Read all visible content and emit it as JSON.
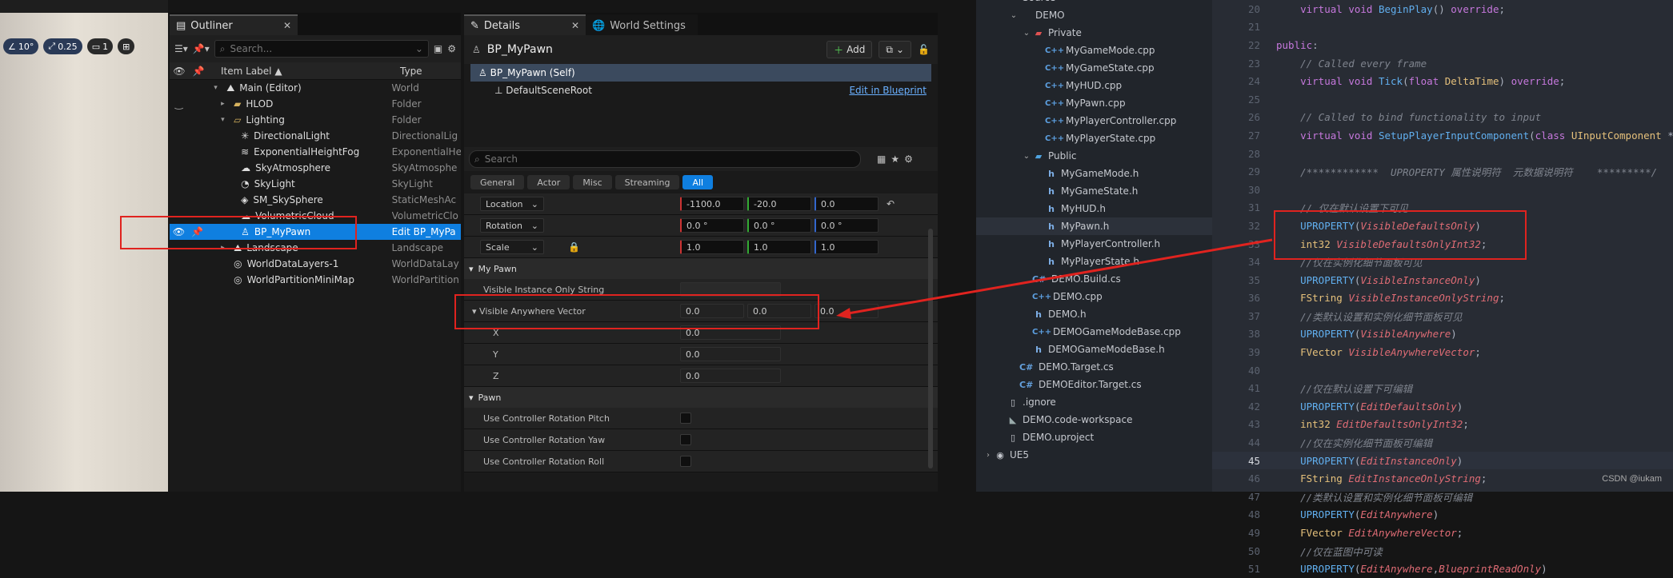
{
  "viewport": {
    "toolbar": [
      {
        "icon": "angle-icon",
        "label": "10°"
      },
      {
        "icon": "scale-icon",
        "label": "0.25"
      },
      {
        "icon": "camera-icon",
        "label": "1"
      }
    ]
  },
  "outliner": {
    "tab_label": "Outliner",
    "search_placeholder": "Search...",
    "columns": {
      "label": "Item Label ▲",
      "type": "Type"
    },
    "rows": [
      {
        "label": "Main (Editor)",
        "type": "World",
        "indent": 2,
        "icon": "world-icon",
        "expanded": true
      },
      {
        "label": "HLOD",
        "type": "Folder",
        "indent": 3,
        "icon": "folder-icon",
        "collapsed": true
      },
      {
        "label": "Lighting",
        "type": "Folder",
        "indent": 3,
        "icon": "folder-open-icon",
        "expanded": true
      },
      {
        "label": "DirectionalLight",
        "type": "DirectionalLig",
        "indent": 4,
        "icon": "sun-icon"
      },
      {
        "label": "ExponentialHeightFog",
        "type": "ExponentialHe",
        "indent": 4,
        "icon": "fog-icon"
      },
      {
        "label": "SkyAtmosphere",
        "type": "SkyAtmosphe",
        "indent": 4,
        "icon": "sky-icon"
      },
      {
        "label": "SkyLight",
        "type": "SkyLight",
        "indent": 4,
        "icon": "skylight-icon"
      },
      {
        "label": "SM_SkySphere",
        "type": "StaticMeshAc",
        "indent": 4,
        "icon": "mesh-icon"
      },
      {
        "label": "VolumetricCloud",
        "type": "VolumetricClo",
        "indent": 4,
        "icon": "cloud-icon"
      },
      {
        "label": "BP_MyPawn",
        "type": "Edit BP_MyPa",
        "indent": 4,
        "icon": "pawn-icon",
        "selected": true
      },
      {
        "label": "Landscape",
        "type": "Landscape",
        "indent": 3,
        "icon": "landscape-icon",
        "collapsed": true
      },
      {
        "label": "WorldDataLayers-1",
        "type": "WorldDataLay",
        "indent": 3,
        "icon": "layers-icon"
      },
      {
        "label": "WorldPartitionMiniMap",
        "type": "WorldPartition",
        "indent": 3,
        "icon": "minimap-icon"
      }
    ]
  },
  "details": {
    "tab_label": "Details",
    "tab2_label": "World Settings",
    "object_name": "BP_MyPawn",
    "add_label": "Add",
    "components": [
      {
        "label": "BP_MyPawn (Self)",
        "selected": true
      },
      {
        "label": "DefaultSceneRoot"
      }
    ],
    "edit_in_blueprint": "Edit in Blueprint",
    "search_placeholder": "Search",
    "filters": [
      "General",
      "Actor",
      "Misc",
      "Streaming",
      "All"
    ],
    "transform": [
      {
        "name": "Location",
        "values": [
          "-1100.0",
          "-20.0",
          "0.0"
        ]
      },
      {
        "name": "Rotation",
        "values": [
          "0.0 °",
          "0.0 °",
          "0.0 °"
        ]
      },
      {
        "name": "Scale",
        "values": [
          "1.0",
          "1.0",
          "1.0"
        ]
      }
    ],
    "category_my_pawn": "My Pawn",
    "visible_instance_only_string": "Visible Instance Only String",
    "visible_anywhere_vector": "Visible Anywhere Vector",
    "vector_values": [
      "0.0",
      "0.0",
      "0.0"
    ],
    "vector_fields": [
      {
        "name": "X",
        "value": "0.0"
      },
      {
        "name": "Y",
        "value": "0.0"
      },
      {
        "name": "Z",
        "value": "0.0"
      }
    ],
    "category_pawn": "Pawn",
    "pawn_props": [
      "Use Controller Rotation Pitch",
      "Use Controller Rotation Yaw",
      "Use Controller Rotation Roll"
    ]
  },
  "explorer": {
    "items": [
      {
        "label": "Source",
        "indent": 1,
        "kind": "folder-open"
      },
      {
        "label": "DEMO",
        "indent": 2,
        "kind": "folder-open"
      },
      {
        "label": "Private",
        "indent": 3,
        "kind": "folder-private"
      },
      {
        "label": "MyGameMode.cpp",
        "indent": 4,
        "kind": "cpp"
      },
      {
        "label": "MyGameState.cpp",
        "indent": 4,
        "kind": "cpp"
      },
      {
        "label": "MyHUD.cpp",
        "indent": 4,
        "kind": "cpp"
      },
      {
        "label": "MyPawn.cpp",
        "indent": 4,
        "kind": "cpp"
      },
      {
        "label": "MyPlayerController.cpp",
        "indent": 4,
        "kind": "cpp"
      },
      {
        "label": "MyPlayerState.cpp",
        "indent": 4,
        "kind": "cpp"
      },
      {
        "label": "Public",
        "indent": 3,
        "kind": "folder-public"
      },
      {
        "label": "MyGameMode.h",
        "indent": 4,
        "kind": "h"
      },
      {
        "label": "MyGameState.h",
        "indent": 4,
        "kind": "h"
      },
      {
        "label": "MyHUD.h",
        "indent": 4,
        "kind": "h"
      },
      {
        "label": "MyPawn.h",
        "indent": 4,
        "kind": "h",
        "selected": true
      },
      {
        "label": "MyPlayerController.h",
        "indent": 4,
        "kind": "h"
      },
      {
        "label": "MyPlayerState.h",
        "indent": 4,
        "kind": "h"
      },
      {
        "label": "DEMO.Build.cs",
        "indent": 3,
        "kind": "cs"
      },
      {
        "label": "DEMO.cpp",
        "indent": 3,
        "kind": "cpp"
      },
      {
        "label": "DEMO.h",
        "indent": 3,
        "kind": "h"
      },
      {
        "label": "DEMOGameModeBase.cpp",
        "indent": 3,
        "kind": "cpp"
      },
      {
        "label": "DEMOGameModeBase.h",
        "indent": 3,
        "kind": "h"
      },
      {
        "label": "DEMO.Target.cs",
        "indent": 2,
        "kind": "cs"
      },
      {
        "label": "DEMOEditor.Target.cs",
        "indent": 2,
        "kind": "cs"
      },
      {
        "label": ".ignore",
        "indent": 1,
        "kind": "file"
      },
      {
        "label": "DEMO.code-workspace",
        "indent": 1,
        "kind": "workspace"
      },
      {
        "label": "DEMO.uproject",
        "indent": 1,
        "kind": "file"
      },
      {
        "label": "UE5",
        "indent": 0,
        "kind": "folder-closed"
      }
    ]
  },
  "code": {
    "current_line": 45,
    "lines": [
      {
        "n": 20,
        "tokens": [
          [
            "    ",
            "pl"
          ],
          [
            "virtual ",
            "kw"
          ],
          [
            "void ",
            "kw"
          ],
          [
            "BeginPlay",
            "fn"
          ],
          [
            "() ",
            "pl"
          ],
          [
            "override",
            "kw"
          ],
          [
            ";",
            "pl"
          ]
        ]
      },
      {
        "n": 21,
        "tokens": []
      },
      {
        "n": 22,
        "tokens": [
          [
            "public",
            "kw"
          ],
          [
            ":",
            "pl"
          ]
        ]
      },
      {
        "n": 23,
        "tokens": [
          [
            "    // Called every frame",
            "cm"
          ]
        ]
      },
      {
        "n": 24,
        "tokens": [
          [
            "    ",
            "pl"
          ],
          [
            "virtual ",
            "kw"
          ],
          [
            "void ",
            "kw"
          ],
          [
            "Tick",
            "fn"
          ],
          [
            "(",
            "pl"
          ],
          [
            "float ",
            "kw"
          ],
          [
            "DeltaTime",
            "vr"
          ],
          [
            ") ",
            "pl"
          ],
          [
            "override",
            "kw"
          ],
          [
            ";",
            "pl"
          ]
        ]
      },
      {
        "n": 25,
        "tokens": []
      },
      {
        "n": 26,
        "tokens": [
          [
            "    // Called to bind functionality to input",
            "cm"
          ]
        ]
      },
      {
        "n": 27,
        "tokens": [
          [
            "    ",
            "pl"
          ],
          [
            "virtual ",
            "kw"
          ],
          [
            "void ",
            "kw"
          ],
          [
            "SetupPlayerInputComponent",
            "fn"
          ],
          [
            "(",
            "pl"
          ],
          [
            "class ",
            "kw"
          ],
          [
            "UInputComponent ",
            "ty"
          ],
          [
            "*",
            "pl"
          ]
        ]
      },
      {
        "n": 28,
        "tokens": []
      },
      {
        "n": 29,
        "tokens": [
          [
            "    /************  UPROPERTY 属性说明符  元数据说明符    *********/",
            "cm"
          ]
        ]
      },
      {
        "n": 30,
        "tokens": []
      },
      {
        "n": 31,
        "tokens": [
          [
            "    // 仅在默认设置下可见",
            "cm"
          ]
        ]
      },
      {
        "n": 32,
        "tokens": [
          [
            "    ",
            "pl"
          ],
          [
            "UPROPERTY",
            "fn"
          ],
          [
            "(",
            "pl"
          ],
          [
            "VisibleDefaultsOnly",
            "it"
          ],
          [
            ")",
            "pl"
          ]
        ]
      },
      {
        "n": 33,
        "tokens": [
          [
            "    ",
            "pl"
          ],
          [
            "int32 ",
            "ty"
          ],
          [
            "VisibleDefaultsOnlyInt32",
            "it"
          ],
          [
            ";",
            "pl"
          ]
        ]
      },
      {
        "n": 34,
        "tokens": [
          [
            "    //仅在实例化细节面板可见",
            "cm"
          ]
        ]
      },
      {
        "n": 35,
        "tokens": [
          [
            "    ",
            "pl"
          ],
          [
            "UPROPERTY",
            "fn"
          ],
          [
            "(",
            "pl"
          ],
          [
            "VisibleInstanceOnly",
            "it"
          ],
          [
            ")",
            "pl"
          ]
        ]
      },
      {
        "n": 36,
        "tokens": [
          [
            "    ",
            "pl"
          ],
          [
            "FString ",
            "ty"
          ],
          [
            "VisibleInstanceOnlyString",
            "it"
          ],
          [
            ";",
            "pl"
          ]
        ]
      },
      {
        "n": 37,
        "tokens": [
          [
            "    //类默认设置和实例化细节面板可见",
            "cm"
          ]
        ]
      },
      {
        "n": 38,
        "tokens": [
          [
            "    ",
            "pl"
          ],
          [
            "UPROPERTY",
            "fn"
          ],
          [
            "(",
            "pl"
          ],
          [
            "VisibleAnywhere",
            "it"
          ],
          [
            ")",
            "pl"
          ]
        ]
      },
      {
        "n": 39,
        "tokens": [
          [
            "    ",
            "pl"
          ],
          [
            "FVector ",
            "ty"
          ],
          [
            "VisibleAnywhereVector",
            "it"
          ],
          [
            ";",
            "pl"
          ]
        ]
      },
      {
        "n": 40,
        "tokens": []
      },
      {
        "n": 41,
        "tokens": [
          [
            "    //仅在默认设置下可编辑",
            "cm"
          ]
        ]
      },
      {
        "n": 42,
        "tokens": [
          [
            "    ",
            "pl"
          ],
          [
            "UPROPERTY",
            "fn"
          ],
          [
            "(",
            "pl"
          ],
          [
            "EditDefaultsOnly",
            "it"
          ],
          [
            ")",
            "pl"
          ]
        ]
      },
      {
        "n": 43,
        "tokens": [
          [
            "    ",
            "pl"
          ],
          [
            "int32 ",
            "ty"
          ],
          [
            "EditDefaultsOnlyInt32",
            "it"
          ],
          [
            ";",
            "pl"
          ]
        ]
      },
      {
        "n": 44,
        "tokens": [
          [
            "    //仅在实例化细节面板可编辑",
            "cm"
          ]
        ]
      },
      {
        "n": 45,
        "tokens": [
          [
            "    ",
            "pl"
          ],
          [
            "UPROPERTY",
            "fn"
          ],
          [
            "(",
            "pl"
          ],
          [
            "EditInstanceOnly",
            "it"
          ],
          [
            ")",
            "pl"
          ]
        ]
      },
      {
        "n": 46,
        "tokens": [
          [
            "    ",
            "pl"
          ],
          [
            "FString ",
            "ty"
          ],
          [
            "EditInstanceOnlyString",
            "it"
          ],
          [
            ";",
            "pl"
          ]
        ]
      },
      {
        "n": 47,
        "tokens": [
          [
            "    //类默认设置和实例化细节面板可编辑",
            "cm"
          ]
        ]
      },
      {
        "n": 48,
        "tokens": [
          [
            "    ",
            "pl"
          ],
          [
            "UPROPERTY",
            "fn"
          ],
          [
            "(",
            "pl"
          ],
          [
            "EditAnywhere",
            "it"
          ],
          [
            ")",
            "pl"
          ]
        ]
      },
      {
        "n": 49,
        "tokens": [
          [
            "    ",
            "pl"
          ],
          [
            "FVector ",
            "ty"
          ],
          [
            "EditAnywhereVector",
            "it"
          ],
          [
            ";",
            "pl"
          ]
        ]
      },
      {
        "n": 50,
        "tokens": [
          [
            "    //仅在蓝图中可读",
            "cm"
          ]
        ]
      },
      {
        "n": 51,
        "tokens": [
          [
            "    ",
            "pl"
          ],
          [
            "UPROPERTY",
            "fn"
          ],
          [
            "(",
            "pl"
          ],
          [
            "EditAnywhere",
            "it"
          ],
          [
            ",",
            "pl"
          ],
          [
            "BlueprintReadOnly",
            "it"
          ],
          [
            ")",
            "pl"
          ]
        ]
      }
    ]
  },
  "watermark": "CSDN @iukam",
  "colors": {
    "annotation": "#e0231f",
    "selection": "#0f7fe0"
  }
}
